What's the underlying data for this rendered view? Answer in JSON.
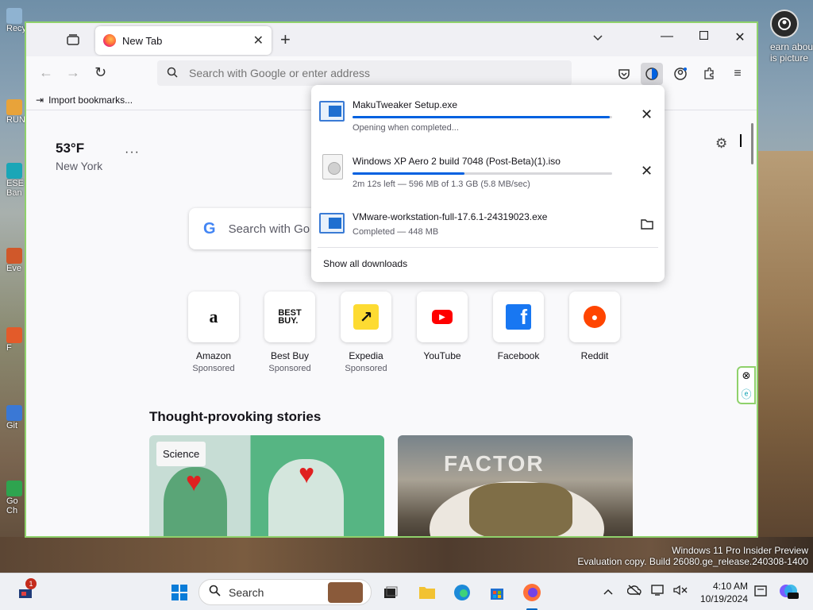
{
  "desktop": {
    "watermark_line1": "Windows 11 Pro Insider Preview",
    "watermark_line2": "Evaluation copy. Build 26080.ge_release.240308-1400",
    "learn_picture": "earn about\nis picture",
    "icons": [
      "Recy",
      "RUN",
      "ESE Ban",
      "Eve",
      "F",
      "Git",
      "Go Ch"
    ]
  },
  "browser": {
    "tab_title": "New Tab",
    "tab_icon": "firefox-icon",
    "url_placeholder": "Search with Google or enter address",
    "bookmarks_import": "Import bookmarks...",
    "weather": {
      "temperature": "53°F",
      "city": "New York"
    },
    "search_placeholder": "Search with Go",
    "shortcuts": [
      {
        "name": "Amazon",
        "sponsored": "Sponsored",
        "icon": "amazon-icon"
      },
      {
        "name": "Best Buy",
        "sponsored": "Sponsored",
        "icon": "bestbuy-icon"
      },
      {
        "name": "Expedia",
        "sponsored": "Sponsored",
        "icon": "expedia-icon"
      },
      {
        "name": "YouTube",
        "sponsored": "",
        "icon": "youtube-icon"
      },
      {
        "name": "Facebook",
        "sponsored": "",
        "icon": "facebook-icon"
      },
      {
        "name": "Reddit",
        "sponsored": "",
        "icon": "reddit-icon"
      }
    ],
    "stories_heading": "Thought-provoking stories",
    "story1_badge": "Science",
    "story2_text": "FACTOR"
  },
  "downloads": {
    "items": [
      {
        "name": "MakuTweaker Setup.exe",
        "status": "Opening when completed...",
        "progress": 0.99,
        "action_icon": "cancel-icon",
        "type": "exe"
      },
      {
        "name": "Windows XP Aero 2 build 7048 (Post-Beta)(1).iso",
        "status": "2m 12s left — 596 MB of 1.3 GB (5.8 MB/sec)",
        "progress": 0.43,
        "action_icon": "cancel-icon",
        "type": "iso"
      },
      {
        "name": "VMware-workstation-full-17.6.1-24319023.exe",
        "status": "Completed — 448 MB",
        "progress": 1.0,
        "action_icon": "folder-icon",
        "type": "exe"
      }
    ],
    "show_all": "Show all downloads"
  },
  "taskbar": {
    "search_placeholder": "Search",
    "notification_count": "1",
    "time": "4:10 AM",
    "date": "10/19/2024"
  }
}
